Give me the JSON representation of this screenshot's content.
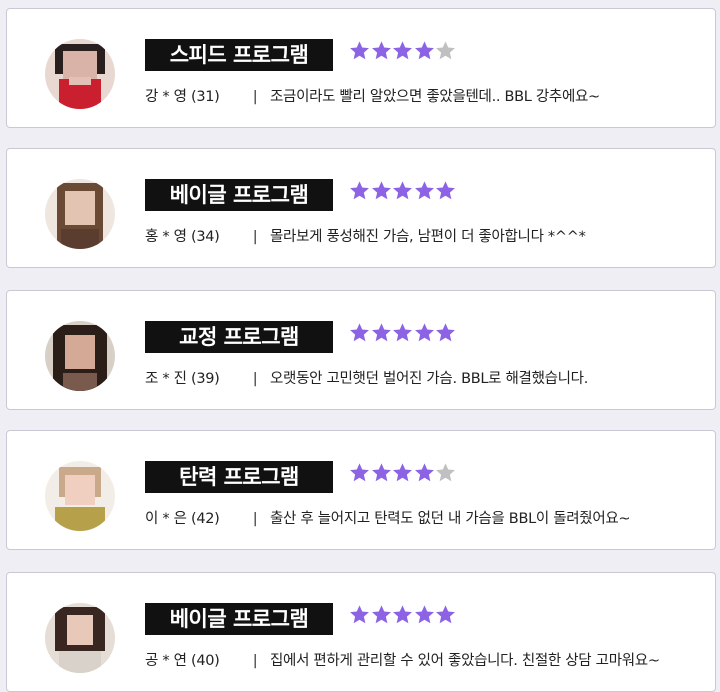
{
  "colors": {
    "star_filled": "#8d63e6",
    "star_empty": "#c0c0c0",
    "badge_bg": "#111111",
    "badge_text": "#ffffff",
    "card_border": "#c9c9d6",
    "page_bg": "#eeeef4"
  },
  "separator": "|",
  "reviews": [
    {
      "program": "스피드 프로그램",
      "rating": 4,
      "reviewer": "강  * 영 (31)",
      "comment": "조금이라도 빨리 알았으면 좋았을텐데.. BBL 강추에요~",
      "avatar_icon": "avatar-blurred-photo"
    },
    {
      "program": "베이글 프로그램",
      "rating": 5,
      "reviewer": "홍  * 영 (34)",
      "comment": "몰라보게 풍성해진 가슴, 남편이 더 좋아합니다 *^^*",
      "avatar_icon": "avatar-blurred-photo"
    },
    {
      "program": "교정 프로그램",
      "rating": 5,
      "reviewer": "조  * 진 (39)",
      "comment": "오랫동안 고민햇던 벌어진 가슴. BBL로 해결했습니다.",
      "avatar_icon": "avatar-blurred-photo"
    },
    {
      "program": "탄력 프로그램",
      "rating": 4,
      "reviewer": "이  * 은 (42)",
      "comment": "출산 후 늘어지고 탄력도 없던 내 가슴을 BBL이 돌려줬어요~",
      "avatar_icon": "avatar-blurred-photo"
    },
    {
      "program": "베이글 프로그램",
      "rating": 5,
      "reviewer": "공  * 연 (40)",
      "comment": "집에서 편하게 관리할 수 있어 좋았습니다. 친절한 상담 고마워요~",
      "avatar_icon": "avatar-blurred-photo"
    }
  ]
}
